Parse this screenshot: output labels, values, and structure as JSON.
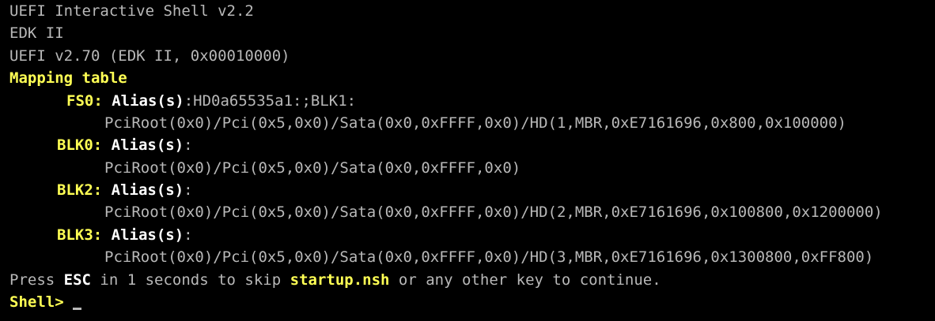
{
  "header": {
    "shell_version": "UEFI Interactive Shell v2.2",
    "firmware": "EDK II",
    "uefi_version": "UEFI v2.70 (EDK II, 0x00010000)"
  },
  "mapping": {
    "title": "Mapping table",
    "entries": [
      {
        "name": "FS0:",
        "alias_label": "Alias(s)",
        "alias_value": ":HD0a65535a1:;BLK1:",
        "path": "PciRoot(0x0)/Pci(0x5,0x0)/Sata(0x0,0xFFFF,0x0)/HD(1,MBR,0xE7161696,0x800,0x100000)"
      },
      {
        "name": "BLK0:",
        "alias_label": "Alias(s)",
        "alias_value": ":",
        "path": "PciRoot(0x0)/Pci(0x5,0x0)/Sata(0x0,0xFFFF,0x0)"
      },
      {
        "name": "BLK2:",
        "alias_label": "Alias(s)",
        "alias_value": ":",
        "path": "PciRoot(0x0)/Pci(0x5,0x0)/Sata(0x0,0xFFFF,0x0)/HD(2,MBR,0xE7161696,0x100800,0x1200000)"
      },
      {
        "name": "BLK3:",
        "alias_label": "Alias(s)",
        "alias_value": ":",
        "path": "PciRoot(0x0)/Pci(0x5,0x0)/Sata(0x0,0xFFFF,0x0)/HD(3,MBR,0xE7161696,0x1300800,0xFF800)"
      }
    ]
  },
  "startup": {
    "press": "Press ",
    "esc": "ESC",
    "mid": " in 1 seconds to skip ",
    "script": "startup.nsh",
    "end": " or any other key to continue."
  },
  "prompt": {
    "label": "Shell>",
    "input_value": ""
  },
  "colors": {
    "background": "#000000",
    "text": "#b8b8b8",
    "highlight_yellow": "#ffff54",
    "highlight_white": "#ffffff"
  }
}
